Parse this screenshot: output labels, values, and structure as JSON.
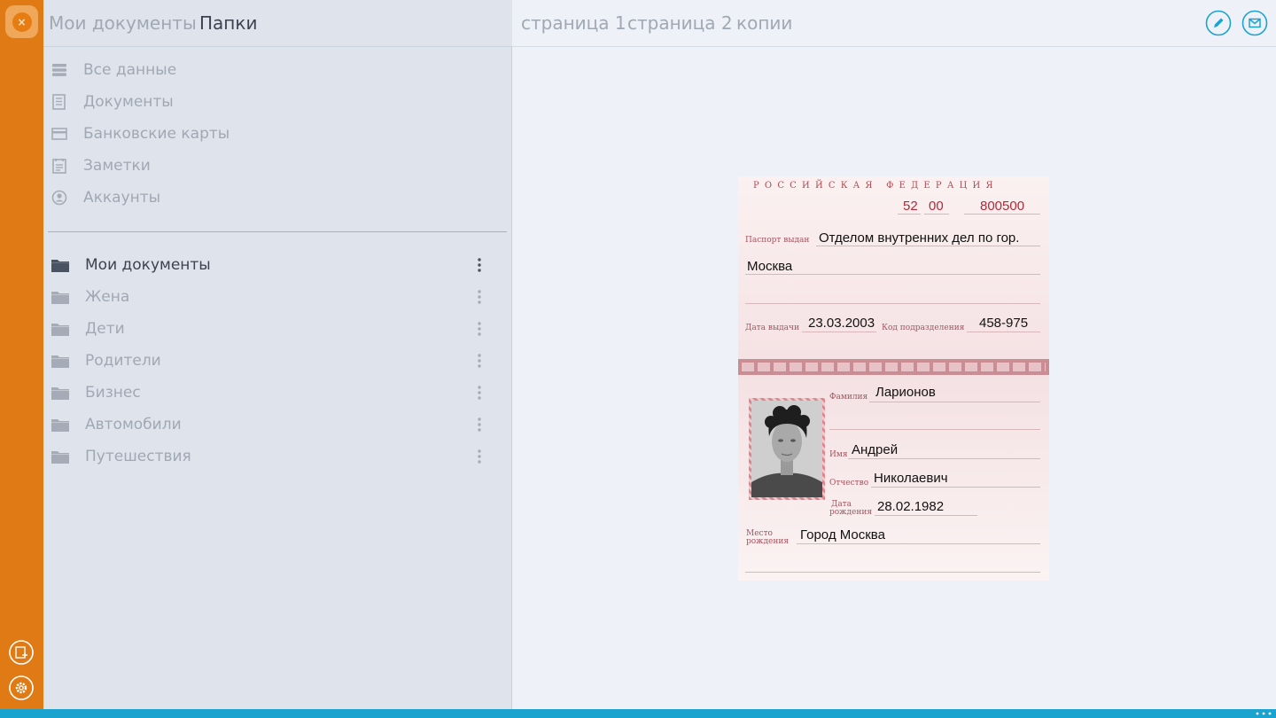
{
  "left_header": {
    "tab_my_docs": "Мои документы",
    "tab_folders": "Папки"
  },
  "categories": [
    {
      "label": "Все данные",
      "icon": "database-icon"
    },
    {
      "label": "Документы",
      "icon": "document-icon"
    },
    {
      "label": "Банковские карты",
      "icon": "card-icon"
    },
    {
      "label": "Заметки",
      "icon": "notes-icon"
    },
    {
      "label": "Аккаунты",
      "icon": "account-icon"
    }
  ],
  "folders": [
    {
      "label": "Мои документы",
      "active": true
    },
    {
      "label": "Жена"
    },
    {
      "label": "Дети"
    },
    {
      "label": "Родители"
    },
    {
      "label": "Бизнес"
    },
    {
      "label": "Автомобили"
    },
    {
      "label": "Путешествия"
    }
  ],
  "page_tabs": [
    "страница 1",
    "страница 2",
    "копии"
  ],
  "passport": {
    "country": "РОССИЙСКАЯ ФЕДЕРАЦИЯ",
    "series_1": "52",
    "series_2": "00",
    "number": "800500",
    "issued_by_label": "Паспорт выдан",
    "issued_by_line1": "Отделом внутренних дел по гор.",
    "issued_by_line2": "Москва",
    "issue_date_label": "Дата выдачи",
    "issue_date": "23.03.2003",
    "dept_code_label": "Код подразделения",
    "dept_code": "458-975",
    "surname_label": "Фамилия",
    "surname": "Ларионов",
    "name_label": "Имя",
    "name": "Андрей",
    "patronymic_label": "Отчество",
    "patronymic": "Николаевич",
    "birth_date_label_1": "Дата",
    "birth_date_label_2": "рождения",
    "birth_date": "28.02.1982",
    "birth_place_label_1": "Место",
    "birth_place_label_2": "рождения",
    "birth_place": "Город Москва"
  },
  "colors": {
    "accent": "#e07a14",
    "bottom_bar": "#1ba3cf",
    "icon_blue": "#1ba3cf"
  }
}
